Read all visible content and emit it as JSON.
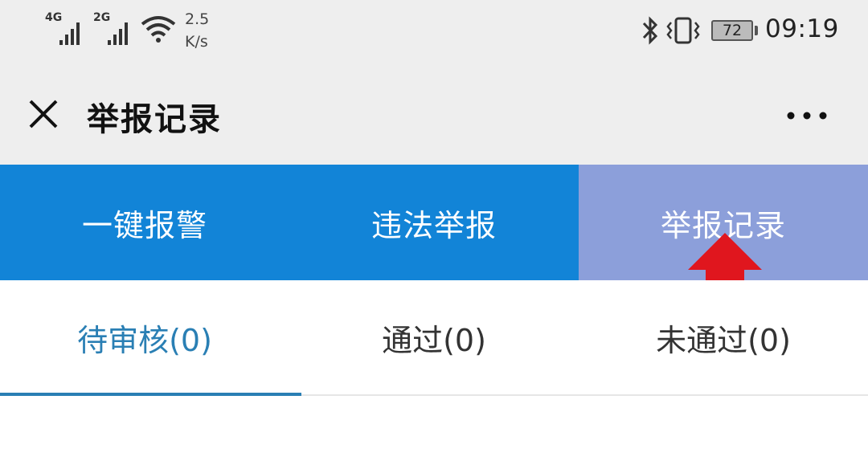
{
  "status_bar": {
    "sim1_label": "4G",
    "sim2_label": "2G",
    "speed_value": "2.5",
    "speed_unit": "K/s",
    "battery_level": "72",
    "time": "09:19"
  },
  "header": {
    "title": "举报记录"
  },
  "nav": {
    "items": [
      {
        "label": "一键报警"
      },
      {
        "label": "违法举报"
      },
      {
        "label": "举报记录"
      }
    ],
    "active_index": 2
  },
  "subtabs": {
    "items": [
      {
        "label": "待审核(0)"
      },
      {
        "label": "通过(0)"
      },
      {
        "label": "未通过(0)"
      }
    ],
    "active_index": 0
  },
  "colors": {
    "nav_blue": "#1284d7",
    "nav_active": "#8c9fda",
    "tab_active": "#2a7fb4",
    "arrow_red": "#e0161e"
  }
}
